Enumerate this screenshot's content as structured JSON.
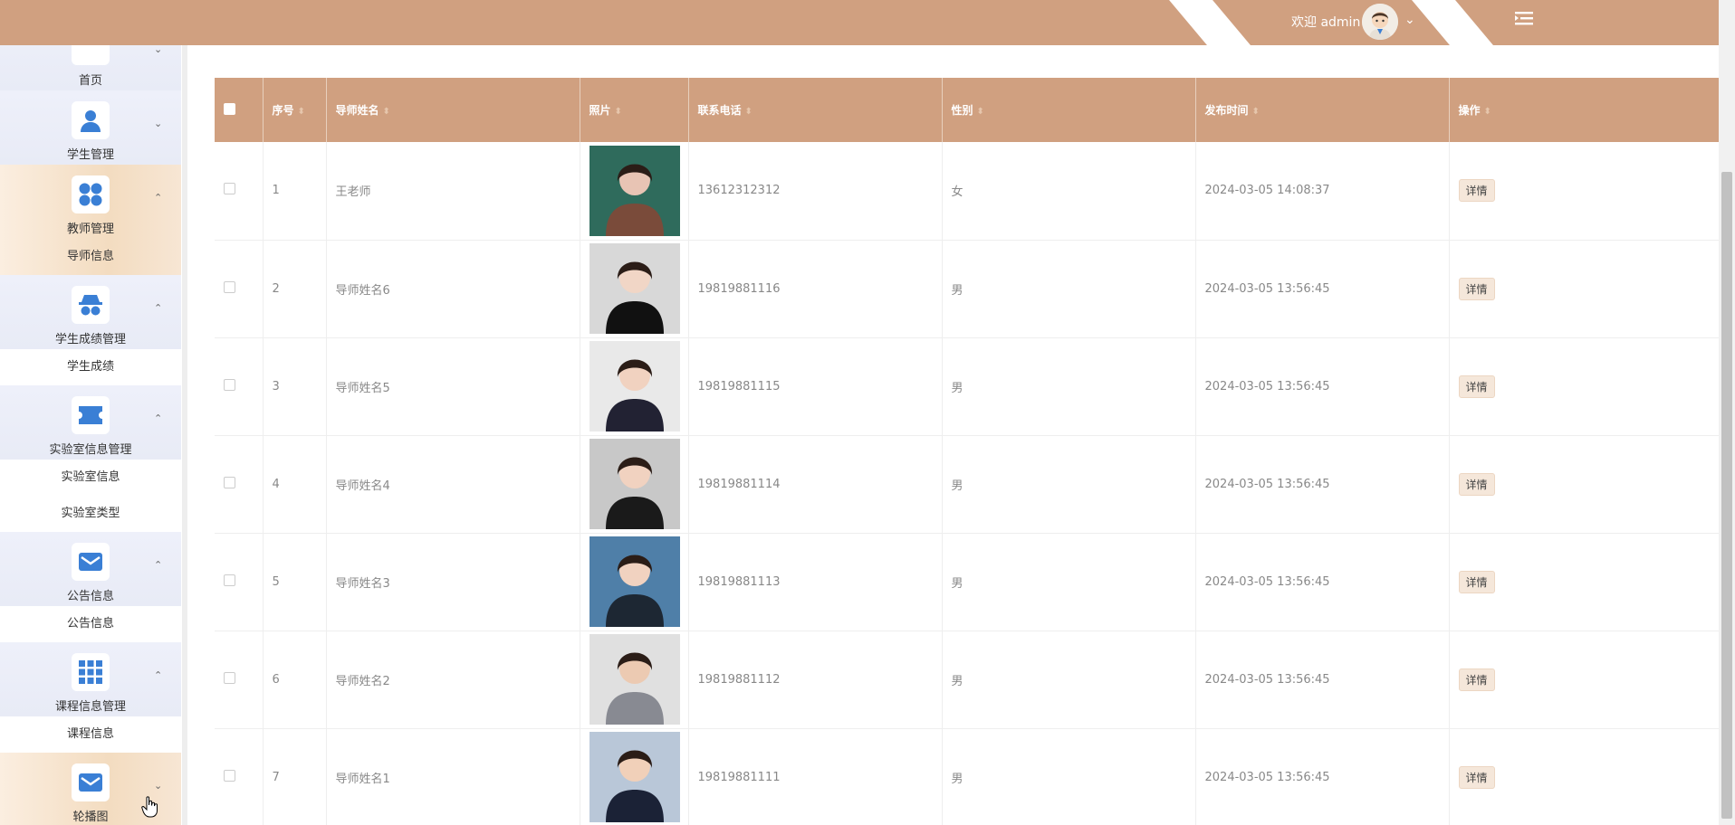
{
  "header": {
    "welcome": "欢迎 admin",
    "caret": "⌄",
    "bg_color": "#d0a080"
  },
  "sidebar": {
    "groups": [
      {
        "label": "首页",
        "icon": "home-icon",
        "arrow": "⌄"
      },
      {
        "label": "学生管理",
        "icon": "user-icon",
        "arrow": "⌄"
      },
      {
        "label": "教师管理",
        "icon": "grid-four-icon",
        "arrow": "⌃",
        "children": [
          "导师信息"
        ]
      },
      {
        "label": "学生成绩管理",
        "icon": "spy-icon",
        "arrow": "⌃",
        "children": [
          "学生成绩"
        ]
      },
      {
        "label": "实验室信息管理",
        "icon": "ticket-icon",
        "arrow": "⌃",
        "children": [
          "实验室信息",
          "实验室类型"
        ]
      },
      {
        "label": "公告信息",
        "icon": "mail-icon",
        "arrow": "⌃",
        "children": [
          "公告信息"
        ]
      },
      {
        "label": "课程信息管理",
        "icon": "apps-icon",
        "arrow": "⌃",
        "children": [
          "课程信息"
        ]
      },
      {
        "label": "轮播图",
        "icon": "mail-icon",
        "arrow": "⌄"
      }
    ]
  },
  "table": {
    "headers": [
      "序号",
      "导师姓名",
      "照片",
      "联系电话",
      "性别",
      "发布时间",
      "操作"
    ],
    "sort_icon": "⬍",
    "action_label": "详情",
    "rows": [
      {
        "no": "1",
        "name": "王老师",
        "phone": "13612312312",
        "gender": "女",
        "time": "2024-03-05 14:08:37"
      },
      {
        "no": "2",
        "name": "导师姓名6",
        "phone": "19819881116",
        "gender": "男",
        "time": "2024-03-05 13:56:45"
      },
      {
        "no": "3",
        "name": "导师姓名5",
        "phone": "19819881115",
        "gender": "男",
        "time": "2024-03-05 13:56:45"
      },
      {
        "no": "4",
        "name": "导师姓名4",
        "phone": "19819881114",
        "gender": "男",
        "time": "2024-03-05 13:56:45"
      },
      {
        "no": "5",
        "name": "导师姓名3",
        "phone": "19819881113",
        "gender": "男",
        "time": "2024-03-05 13:56:45"
      },
      {
        "no": "6",
        "name": "导师姓名2",
        "phone": "19819881112",
        "gender": "男",
        "time": "2024-03-05 13:56:45"
      },
      {
        "no": "7",
        "name": "导师姓名1",
        "phone": "19819881111",
        "gender": "男",
        "time": "2024-03-05 13:56:45"
      }
    ]
  }
}
